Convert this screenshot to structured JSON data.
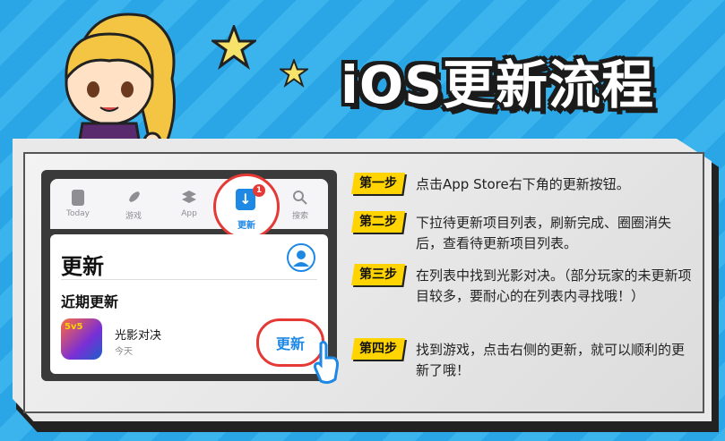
{
  "title": "iOS更新流程",
  "colors": {
    "accent": "#ffd400",
    "bg": "#2aa6e6",
    "highlight": "#e53935",
    "ios_blue": "#1e88e5"
  },
  "phone": {
    "tabs": [
      {
        "label": "Today",
        "icon": "today-icon"
      },
      {
        "label": "游戏",
        "icon": "rocket-icon"
      },
      {
        "label": "App",
        "icon": "layers-icon"
      },
      {
        "label": "更新",
        "icon": "download-icon",
        "selected": true,
        "badge": "1"
      },
      {
        "label": "搜索",
        "icon": "search-icon"
      }
    ],
    "list_title": "更新",
    "recent_heading": "近期更新",
    "app": {
      "name": "光影对决",
      "date": "今天",
      "icon_text": "5v5"
    },
    "update_button": "更新"
  },
  "steps": [
    {
      "tag": "第一步",
      "text": "点击App Store右下角的更新按钮。"
    },
    {
      "tag": "第二步",
      "text": "下拉待更新项目列表，刷新完成、圈圈消失后，查看待更新项目列表。"
    },
    {
      "tag": "第三步",
      "text": "在列表中找到光影对决。（部分玩家的未更新项目较多，要耐心的在列表内寻找哦！）"
    },
    {
      "tag": "第四步",
      "text": "找到游戏，点击右侧的更新，就可以顺利的更新了哦！"
    }
  ]
}
